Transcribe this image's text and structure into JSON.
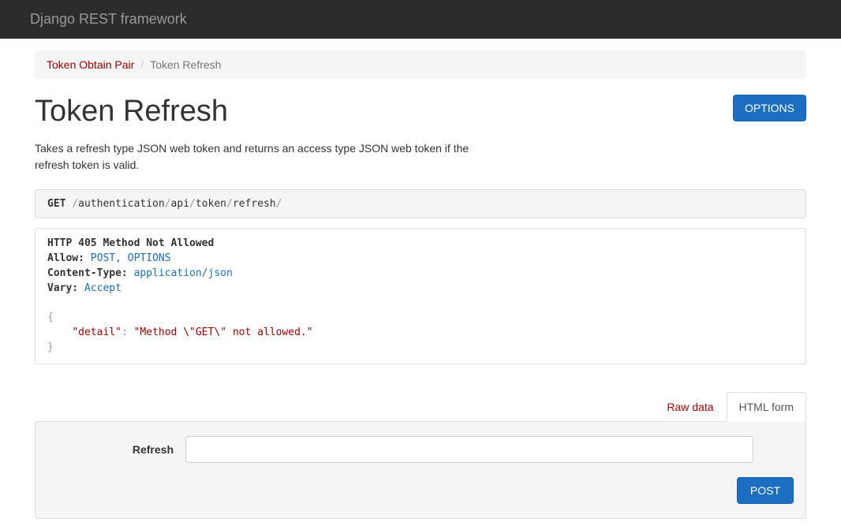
{
  "navbar": {
    "brand": "Django REST framework"
  },
  "breadcrumb": {
    "root": "Token Obtain Pair",
    "current": "Token Refresh"
  },
  "page": {
    "title": "Token Refresh",
    "options_button": "OPTIONS",
    "description": "Takes a refresh type JSON web token and returns an access type JSON web token if the refresh token is valid."
  },
  "request": {
    "method": "GET",
    "segments": [
      "authentication",
      "api",
      "token",
      "refresh"
    ]
  },
  "response": {
    "status": "HTTP 405 Method Not Allowed",
    "headers": {
      "allow_key": "Allow:",
      "allow_val": "POST, OPTIONS",
      "ctype_key": "Content-Type:",
      "ctype_val": "application/json",
      "vary_key": "Vary:",
      "vary_val": "Accept"
    },
    "body": {
      "open": "{",
      "key": "\"detail\"",
      "colon": ":",
      "val": "\"Method \\\"GET\\\" not allowed.\"",
      "close": "}"
    }
  },
  "tabs": {
    "raw": "Raw data",
    "html": "HTML form"
  },
  "form": {
    "label": "Refresh",
    "value": "",
    "submit": "POST"
  }
}
